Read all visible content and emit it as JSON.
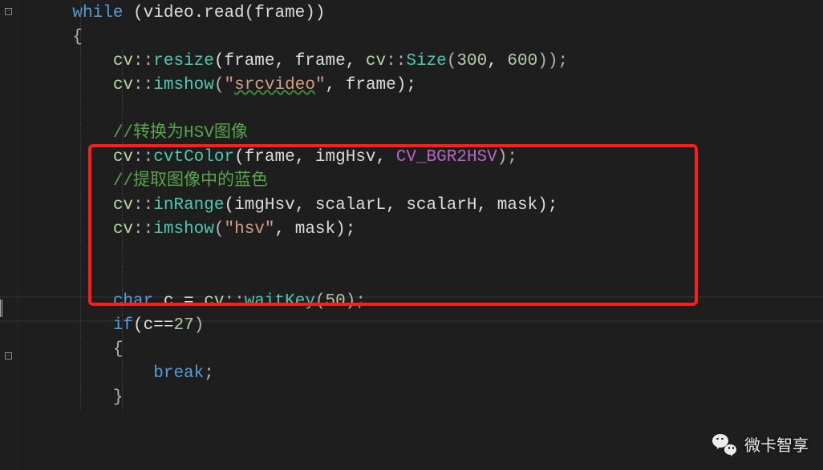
{
  "code": {
    "l1_while": "while",
    "l1_rest": " (video.read(frame))",
    "l2": "{",
    "l3_ns": "cv",
    "l3_sep": "::",
    "l3_fn": "resize",
    "l3_args_a": "(frame, frame, ",
    "l3_ns2": "cv",
    "l3_sep2": "::",
    "l3_size": "Size",
    "l3_open": "(",
    "l3_n1": "300",
    "l3_comma": ", ",
    "l3_n2": "600",
    "l3_close": "));",
    "l4_ns": "cv",
    "l4_sep": "::",
    "l4_fn": "imshow",
    "l4_open": "(",
    "l4_q1": "\"",
    "l4_str": "srcvideo",
    "l4_q2": "\"",
    "l4_rest": ", frame);",
    "l6_cmt": "//转换为HSV图像",
    "l7_ns": "cv",
    "l7_sep": "::",
    "l7_fn": "cvtColor",
    "l7_args": "(frame, imgHsv, ",
    "l7_mac": "CV_BGR2HSV",
    "l7_end": ");",
    "l8_cmt": "//提取图像中的蓝色",
    "l9_ns": "cv",
    "l9_sep": "::",
    "l9_fn": "inRange",
    "l9_args": "(imgHsv, scalarL, scalarH, mask);",
    "l10_ns": "cv",
    "l10_sep": "::",
    "l10_fn": "imshow",
    "l10_open": "(",
    "l10_str": "\"hsv\"",
    "l10_rest": ", mask);",
    "l12_char": "char",
    "l12_rest": " c = ",
    "l12_ns": "cv",
    "l12_sep": "::",
    "l12_fn": "waitKey",
    "l12_open": "(",
    "l12_num": "50",
    "l12_close": ");",
    "l13_if": "if",
    "l13_rest": "(c==",
    "l13_num": "27",
    "l13_close": ")",
    "l14": "{",
    "l15_break": "break",
    "l15_semi": ";",
    "l16": "}"
  },
  "watermark": {
    "text": "微卡智享"
  }
}
